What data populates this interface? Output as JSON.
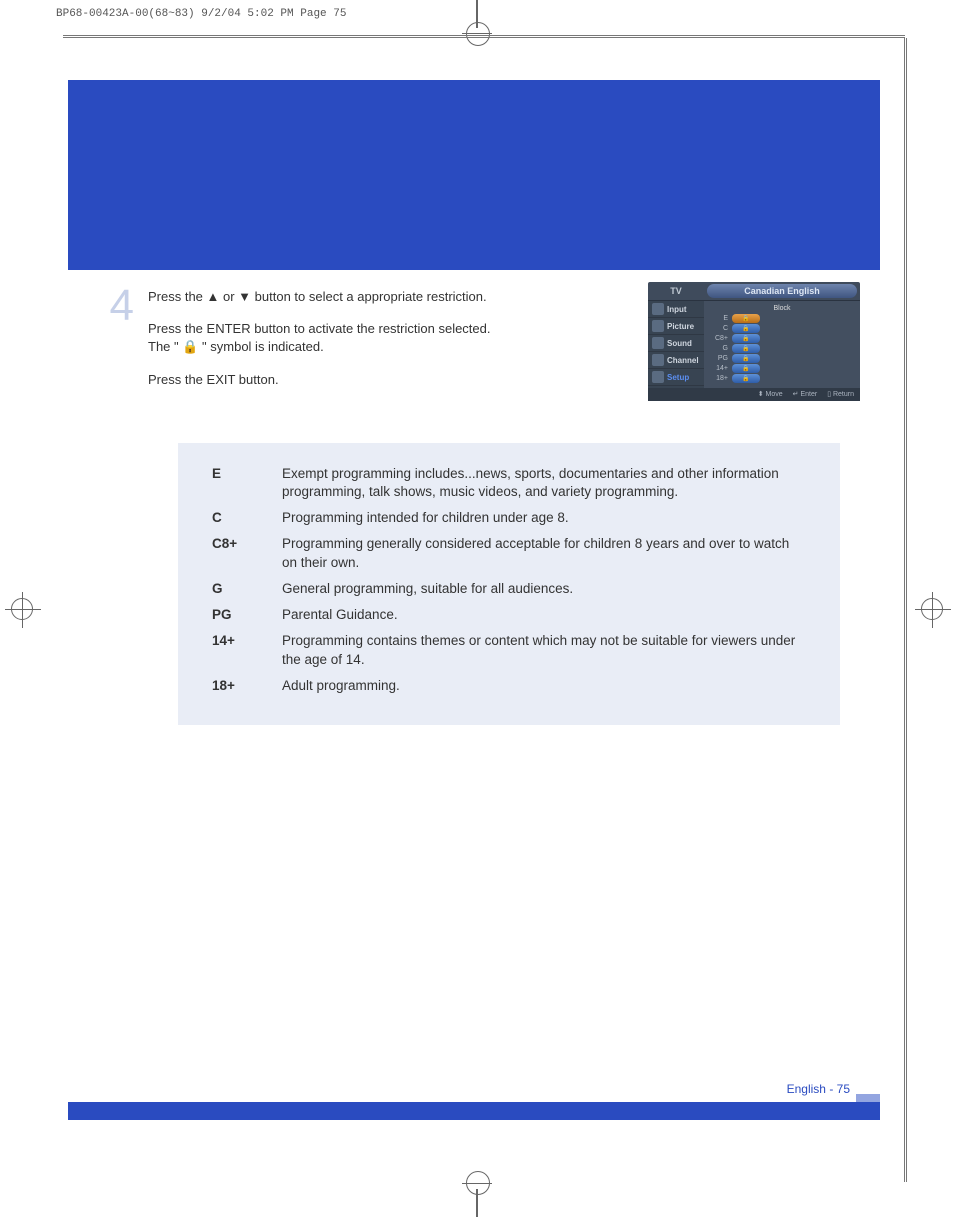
{
  "print_header": "BP68-00423A-00(68~83)  9/2/04  5:02 PM  Page 75",
  "step": {
    "number": "4",
    "line1": "Press the ▲ or ▼ button to select a appropriate restriction.",
    "line2": "Press the ENTER button to activate the restriction selected.",
    "line3": "The \" 🔒 \" symbol is indicated.",
    "line4": "Press the EXIT button."
  },
  "osd": {
    "tv": "TV",
    "title": "Canadian English",
    "side": [
      "Input",
      "Picture",
      "Sound",
      "Channel",
      "Setup"
    ],
    "block_label": "Block",
    "ratings": [
      "E",
      "C",
      "C8+",
      "G",
      "PG",
      "14+",
      "18+"
    ],
    "footer": {
      "move": "Move",
      "enter": "Enter",
      "return": "Return"
    }
  },
  "ratings": [
    {
      "key": "E",
      "desc": "Exempt programming includes...news, sports, documentaries and other information programming, talk shows, music videos, and variety programming."
    },
    {
      "key": "C",
      "desc": "Programming intended for children under age 8."
    },
    {
      "key": "C8+",
      "desc": "Programming generally considered acceptable for children 8 years and over to watch on their own."
    },
    {
      "key": "G",
      "desc": "General programming, suitable for all audiences."
    },
    {
      "key": "PG",
      "desc": "Parental Guidance."
    },
    {
      "key": "14+",
      "desc": "Programming contains themes or content which may not be suitable for viewers under the age of 14."
    },
    {
      "key": "18+",
      "desc": "Adult programming."
    }
  ],
  "page_footer": "English - 75"
}
